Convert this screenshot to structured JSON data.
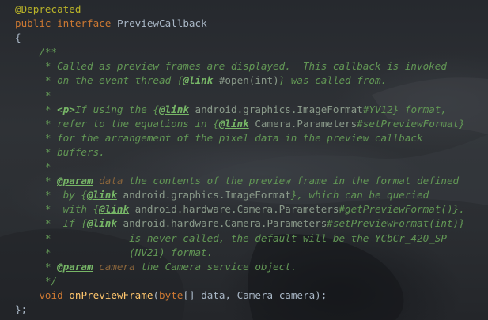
{
  "code": {
    "annotation": "@Deprecated",
    "decl_public": "public",
    "decl_interface": "interface",
    "decl_name": "PreviewCallback",
    "open_brace": "{",
    "doc_open": "/**",
    "d1": "* Called as preview frames are displayed.  This callback is invoked",
    "d2_pre": "* on the event thread ",
    "d2_brace": "{",
    "d2_tag": "@link",
    "d2_ref": " #open(int)",
    "d2_post": "} was called from.",
    "d3": "*",
    "d4_star": "* ",
    "d4_p": "<p>",
    "d4_mid": "If using the {",
    "d4_tag": "@link",
    "d4_ref": " android.graphics.ImageFormat",
    "d4_ref2": "#YV12",
    "d4_post": "} format,",
    "d5_pre": "* refer to the equations in {",
    "d5_tag": "@link",
    "d5_ref": " Camera.Parameters",
    "d5_ref2": "#setPreviewFormat",
    "d5_post": "}",
    "d6": "* for the arrangement of the pixel data in the preview callback",
    "d7": "* buffers.",
    "d8": "*",
    "d9_star": "* ",
    "d9_tag": "@param",
    "d9_name": " data",
    "d9_post": " the contents of the preview frame in the format defined",
    "d10_pre": "*  by {",
    "d10_tag": "@link",
    "d10_ref": " android.graphics.ImageFormat",
    "d10_post": "}, which can be queried",
    "d11_pre": "*  with {",
    "d11_tag": "@link",
    "d11_ref": " android.hardware.Camera.Parameters",
    "d11_ref2": "#getPreviewFormat()",
    "d11_post": "}.",
    "d12_pre": "*  If {",
    "d12_tag": "@link",
    "d12_ref": " android.hardware.Camera.Parameters",
    "d12_ref2": "#setPreviewFormat(int)",
    "d12_post": "}",
    "d13": "*             is never called, the default will be the YCbCr_420_SP",
    "d14": "*             (NV21) format.",
    "d15_star": "* ",
    "d15_tag": "@param",
    "d15_name": " camera",
    "d15_post": " the Camera service object.",
    "doc_close": "*/",
    "m_void": "void",
    "m_name": "onPreviewFrame",
    "m_open": "(",
    "m_byte": "byte",
    "m_args": "[] data, Camera camera);",
    "close_brace": "};"
  }
}
